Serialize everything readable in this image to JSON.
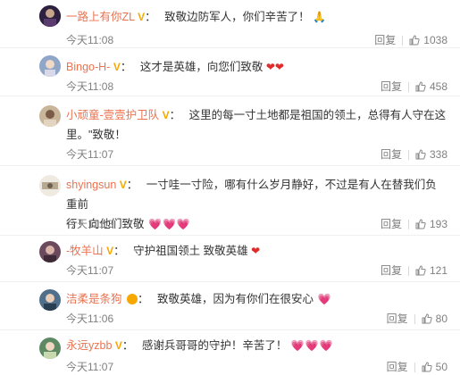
{
  "comments": [
    {
      "username": "一路上有你ZL",
      "badge": "V",
      "colon": "：",
      "text": "致敬边防军人，你们辛苦了！",
      "emoji": [
        "pray"
      ],
      "time": "今天11:08",
      "reply": "回复",
      "likes": "1038",
      "avatar_color": "#2e2140"
    },
    {
      "username": "Bingo-H-",
      "badge": "V",
      "colon": "：",
      "text": "这才是英雄，向您们致敬",
      "emoji": [
        "heart",
        "heart"
      ],
      "time": "今天11:08",
      "reply": "回复",
      "likes": "458",
      "avatar_color": "#8fa6c9"
    },
    {
      "username": "小顽童-壹壹护卫队",
      "badge": "V",
      "colon": "：",
      "text_line1": "这里的每一寸土地都是祖国的领土，总得有人守在这",
      "text_line2": "里。\"致敬！",
      "time": "今天11:07",
      "reply": "回复",
      "likes": "338",
      "avatar_color": "#c9b59a"
    },
    {
      "username": "shyingsun",
      "badge": "V",
      "colon": "：",
      "text_line1": "一寸哇一寸险，哪有什么岁月静好，不过是有人在替我们负重前",
      "text_line2": "行！向他们致敬",
      "emoji": [
        "pink-heart",
        "pink-heart",
        "pink-heart"
      ],
      "time": "今天11:13",
      "reply": "回复",
      "likes": "193",
      "avatar_color": "#d9d3c7"
    },
    {
      "username": "-牧羊山",
      "badge": "V",
      "colon": "：",
      "text": "守护祖国领土 致敬英雄",
      "emoji": [
        "heart"
      ],
      "time": "今天11:07",
      "reply": "回复",
      "likes": "121",
      "avatar_color": "#6b4a5e"
    },
    {
      "username": "洁柔是条狗",
      "badge": "",
      "colon": "：",
      "text": "致敬英雄，因为有你们在很安心",
      "emoji": [
        "pink-heart"
      ],
      "time": "今天11:06",
      "reply": "回复",
      "likes": "80",
      "avatar_color": "#4f6f8a"
    },
    {
      "username": "永远yzbb",
      "badge": "V",
      "colon": "：",
      "text": "感谢兵哥哥的守护！辛苦了！",
      "emoji": [
        "pink-heart",
        "pink-heart",
        "pink-heart"
      ],
      "time": "今天11:07",
      "reply": "回复",
      "likes": "50",
      "avatar_color": "#5d8a62"
    }
  ]
}
